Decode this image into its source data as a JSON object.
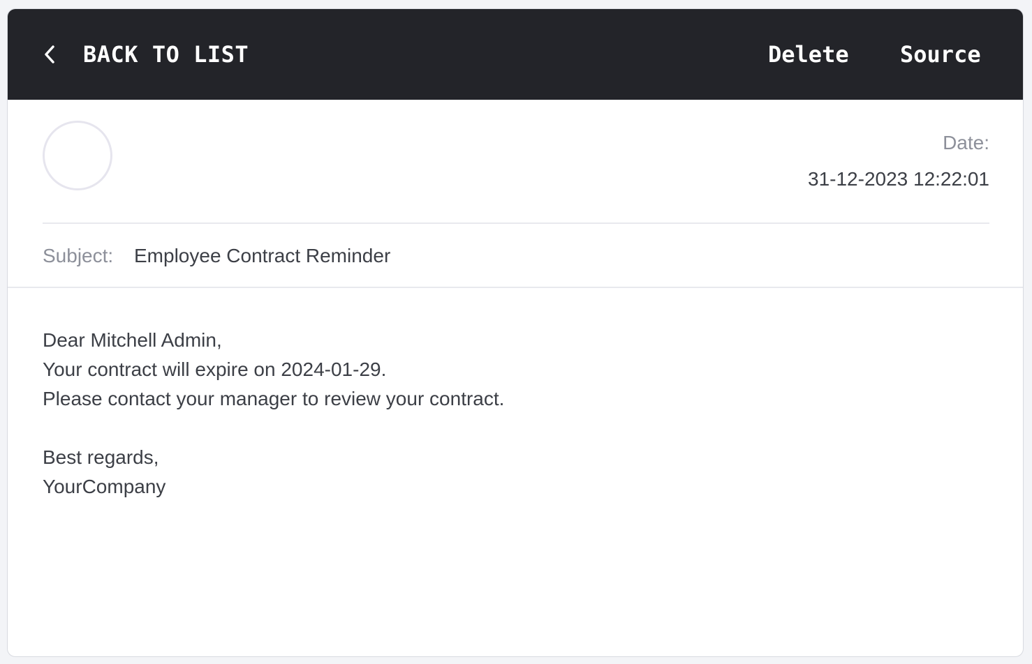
{
  "toolbar": {
    "back_label": "BACK TO LIST",
    "back_icon": "chevron-left-icon",
    "actions": {
      "delete": "Delete",
      "source": "Source"
    }
  },
  "header": {
    "date_label": "Date:",
    "date_value": "31-12-2023 12:22:01"
  },
  "subject": {
    "label": "Subject:",
    "value": "Employee Contract Reminder"
  },
  "message": {
    "greeting": "Dear Mitchell Admin,",
    "line1": "Your contract will expire on 2024-01-29.",
    "line2": "Please contact your manager to review your contract.",
    "closing": "Best regards,",
    "signature": "YourCompany"
  },
  "colors": {
    "topbar_bg": "#232429",
    "muted_text": "#8d909a",
    "body_text": "#3c3f46"
  }
}
